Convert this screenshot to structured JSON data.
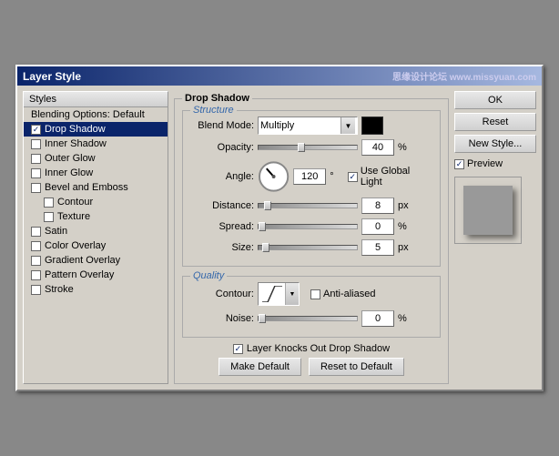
{
  "dialog": {
    "title": "Layer Style",
    "title_right": "思缘设计论坛 www.missyuan.com"
  },
  "left_panel": {
    "header": "Styles",
    "items": [
      {
        "label": "Blending Options: Default",
        "type": "header",
        "indent": 0
      },
      {
        "label": "Drop Shadow",
        "type": "checkbox",
        "checked": true,
        "selected": true,
        "indent": 0
      },
      {
        "label": "Inner Shadow",
        "type": "checkbox",
        "checked": false,
        "selected": false,
        "indent": 0
      },
      {
        "label": "Outer Glow",
        "type": "checkbox",
        "checked": false,
        "selected": false,
        "indent": 0
      },
      {
        "label": "Inner Glow",
        "type": "checkbox",
        "checked": false,
        "selected": false,
        "indent": 0
      },
      {
        "label": "Bevel and Emboss",
        "type": "checkbox",
        "checked": false,
        "selected": false,
        "indent": 0
      },
      {
        "label": "Contour",
        "type": "checkbox",
        "checked": false,
        "selected": false,
        "indent": 1
      },
      {
        "label": "Texture",
        "type": "checkbox",
        "checked": false,
        "selected": false,
        "indent": 1
      },
      {
        "label": "Satin",
        "type": "checkbox",
        "checked": false,
        "selected": false,
        "indent": 0
      },
      {
        "label": "Color Overlay",
        "type": "checkbox",
        "checked": false,
        "selected": false,
        "indent": 0
      },
      {
        "label": "Gradient Overlay",
        "type": "checkbox",
        "checked": false,
        "selected": false,
        "indent": 0
      },
      {
        "label": "Pattern Overlay",
        "type": "checkbox",
        "checked": false,
        "selected": false,
        "indent": 0
      },
      {
        "label": "Stroke",
        "type": "checkbox",
        "checked": false,
        "selected": false,
        "indent": 0
      }
    ]
  },
  "drop_shadow": {
    "section_title": "Drop Shadow",
    "structure_title": "Structure",
    "blend_mode_label": "Blend Mode:",
    "blend_mode_value": "Multiply",
    "opacity_label": "Opacity:",
    "opacity_value": "40",
    "opacity_unit": "%",
    "angle_label": "Angle:",
    "angle_value": "120",
    "angle_unit": "°",
    "use_global_light_label": "Use Global Light",
    "use_global_light_checked": true,
    "distance_label": "Distance:",
    "distance_value": "8",
    "distance_unit": "px",
    "spread_label": "Spread:",
    "spread_value": "0",
    "spread_unit": "%",
    "size_label": "Size:",
    "size_value": "5",
    "size_unit": "px",
    "quality_title": "Quality",
    "contour_label": "Contour:",
    "anti_aliased_label": "Anti-aliased",
    "anti_aliased_checked": false,
    "noise_label": "Noise:",
    "noise_value": "0",
    "noise_unit": "%",
    "layer_knocks_label": "Layer Knocks Out Drop Shadow",
    "layer_knocks_checked": true,
    "make_default_btn": "Make Default",
    "reset_to_default_btn": "Reset to Default"
  },
  "buttons": {
    "ok": "OK",
    "reset": "Reset",
    "new_style": "New Style...",
    "preview_label": "Preview"
  }
}
